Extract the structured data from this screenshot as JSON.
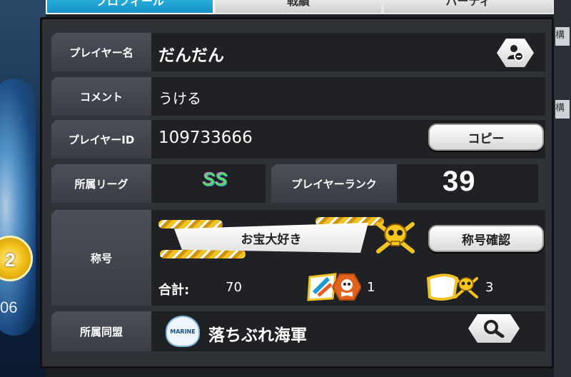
{
  "tabs": [
    {
      "label": "プロフィール",
      "active": true
    },
    {
      "label": "戦績",
      "active": false
    },
    {
      "label": "パーティ",
      "active": false
    }
  ],
  "profile": {
    "player_name_label": "プレイヤー名",
    "player_name": "だんだん",
    "comment_label": "コメント",
    "comment": "うける",
    "player_id_label": "プレイヤーID",
    "player_id": "109733666",
    "copy_button": "コピー",
    "league_label": "所属リーグ",
    "league_badge": "SS",
    "rank_label": "プレイヤーランク",
    "rank_value": "39",
    "title_label": "称号",
    "title_value": "お宝大好き",
    "title_confirm_button": "称号確認",
    "total_label": "合計:",
    "total_value": "70",
    "category1_count": "1",
    "category2_count": "3",
    "alliance_label": "所属同盟",
    "alliance_name": "落ちぶれ海軍",
    "alliance_emblem_text": "MARINE"
  },
  "background": {
    "left_badge_number": "2",
    "left_number": "06",
    "right_strip_glyph": "構"
  },
  "colors": {
    "tab_active": "#1a9fd1",
    "panel_bg": "#2f3237",
    "row_bg": "#1f2125",
    "label_bg": "#43474d",
    "badge_gold": "#f2c21a"
  }
}
